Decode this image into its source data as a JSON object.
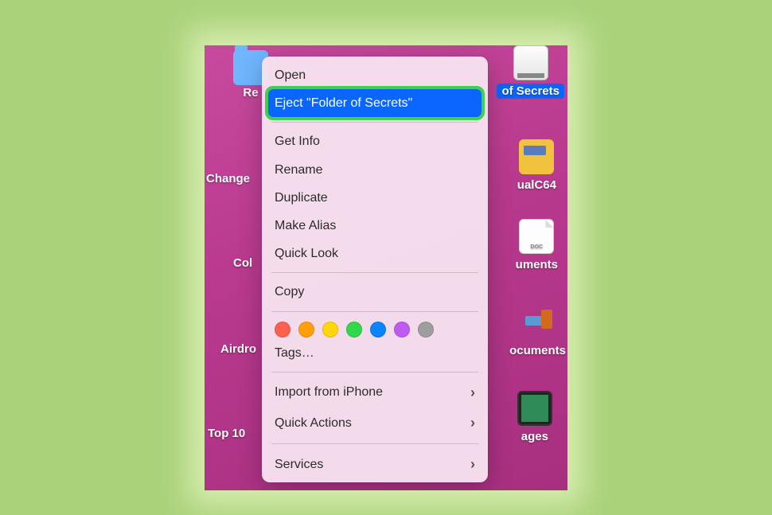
{
  "desktop": {
    "icons": [
      {
        "label": "of Secrets",
        "selected": true,
        "kind": "drive"
      },
      {
        "label": "ualC64",
        "kind": "card"
      },
      {
        "label": "uments",
        "kind": "doc"
      },
      {
        "label": "ocuments",
        "kind": "stick"
      },
      {
        "label": "ages",
        "kind": "win"
      }
    ],
    "left_labels": [
      "Re",
      "Change",
      "Col",
      "Airdro",
      "Top 10"
    ]
  },
  "menu": {
    "open": "Open",
    "eject": "Eject \"Folder of Secrets\"",
    "get_info": "Get Info",
    "rename": "Rename",
    "duplicate": "Duplicate",
    "make_alias": "Make Alias",
    "quick_look": "Quick Look",
    "copy": "Copy",
    "tags": "Tags…",
    "import": "Import from iPhone",
    "quick_actions": "Quick Actions",
    "services": "Services"
  },
  "tag_colors": [
    "#ff5f4e",
    "#ff9f0a",
    "#ffd60a",
    "#32d74b",
    "#0a84ff",
    "#bf5af2",
    "#9e9e9e"
  ]
}
